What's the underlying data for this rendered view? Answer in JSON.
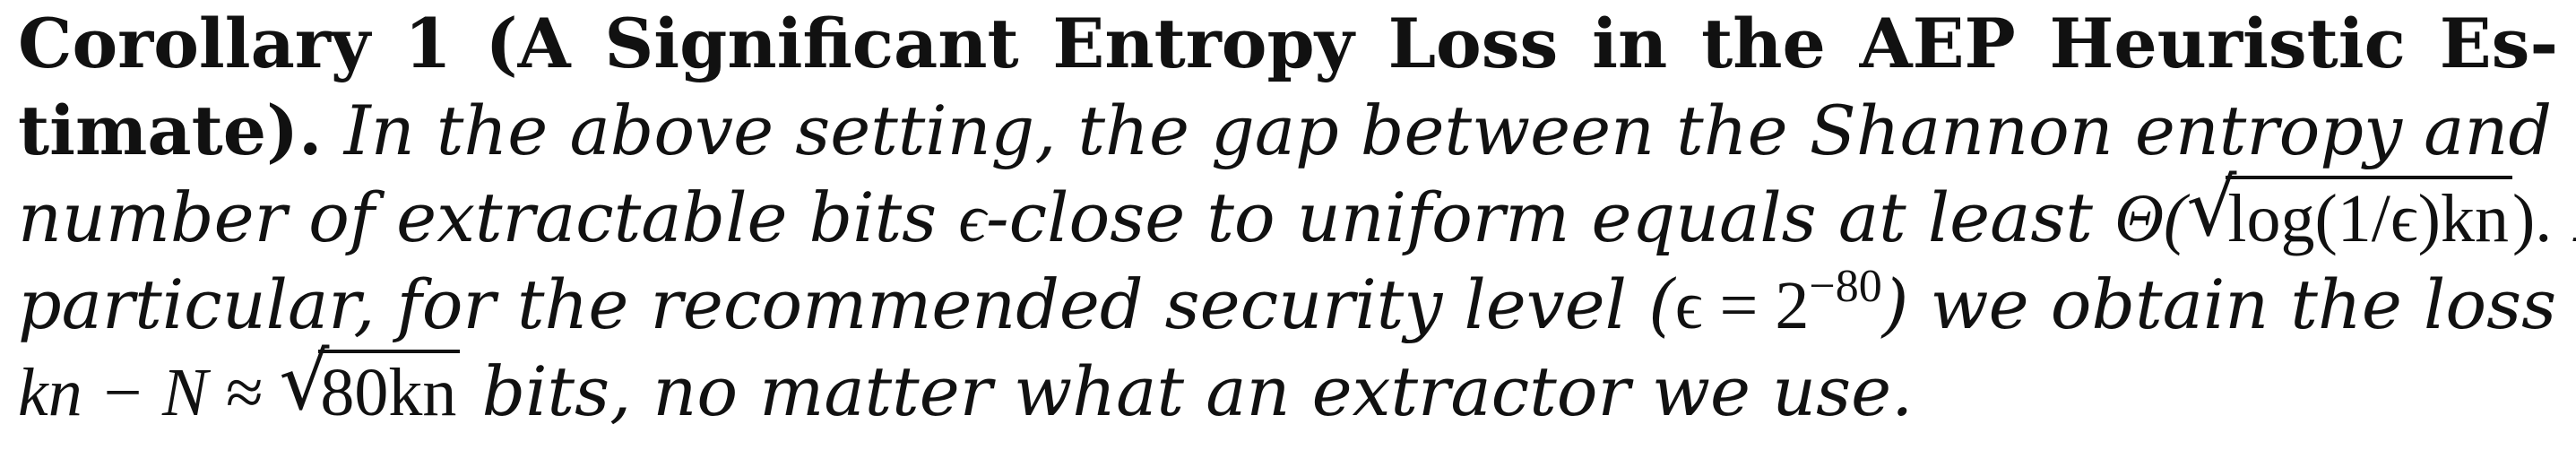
{
  "corollary": {
    "heading_line1": "Corollary 1 (A Significant Entropy Loss in the AEP Heuristic Es-",
    "heading_line2": "timate).",
    "line2_rest": "In the above setting, the gap between the Shannon entropy and the",
    "line3_pre": "number of extractable bits ",
    "epsilon": "ϵ",
    "line3_mid": "-close to uniform equals at least ",
    "theta_open": "Θ(",
    "sqrt_arg": "log(1/ϵ)kn",
    "theta_close": ").",
    "line3_post": " In",
    "line4_pre": "particular, for the recommended security level (",
    "line4_eq": "ϵ = 2",
    "line4_exp": "−80",
    "line4_post": ") we obtain the loss of",
    "line5_expr": "kn − N ≈ ",
    "line5_sqrt": "80kn",
    "line5_post": " bits, no matter what an extractor we use."
  }
}
